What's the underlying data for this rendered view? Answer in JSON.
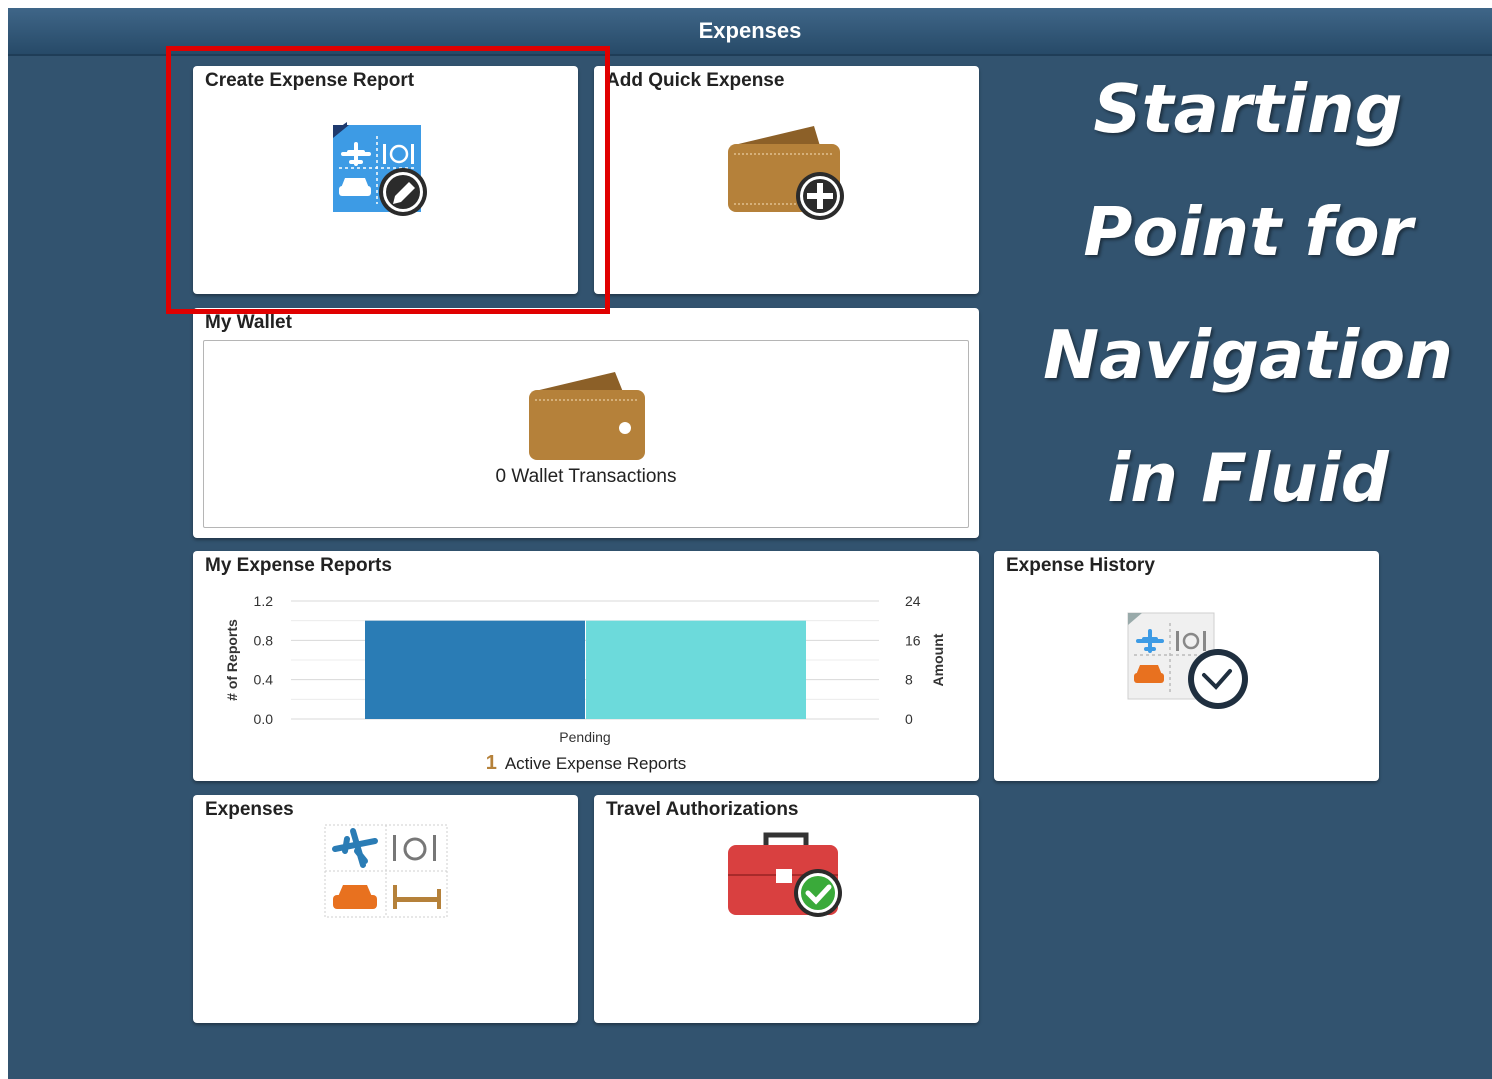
{
  "header": {
    "title": "Expenses"
  },
  "tiles": {
    "create_expense_report": {
      "title": "Create Expense Report"
    },
    "add_quick_expense": {
      "title": "Add Quick Expense"
    },
    "my_wallet": {
      "title": "My Wallet",
      "transactions": "0 Wallet Transactions"
    },
    "my_expense_reports": {
      "title": "My Expense Reports",
      "count": "1",
      "count_label": "Active Expense Reports"
    },
    "expense_history": {
      "title": "Expense History"
    },
    "expenses": {
      "title": "Expenses"
    },
    "travel_authorizations": {
      "title": "Travel Authorizations"
    }
  },
  "tagline": {
    "lines": [
      "Starting",
      "Point for",
      "Navigation",
      "in Fluid"
    ]
  },
  "chart_data": {
    "type": "bar",
    "categories": [
      "Pending"
    ],
    "series": [
      {
        "axis": "left",
        "values": [
          1
        ],
        "color": "#2a7cb5"
      },
      {
        "axis": "right",
        "values": [
          20
        ],
        "color": "#6cdadb"
      }
    ],
    "ylabel": "# of Reports",
    "ylabel_right": "Amount",
    "ylim": [
      0,
      1.2
    ],
    "yticks": [
      "0.0",
      "0.4",
      "0.8",
      "1.2"
    ],
    "ylim_right": [
      0,
      24
    ],
    "yticks_right": [
      "0",
      "8",
      "16",
      "24"
    ],
    "grid": true
  },
  "colors": {
    "background": "#32536f",
    "header": "#2d5273",
    "highlight": "#e00000",
    "wallet": "#b5813a",
    "report_blue": "#3d9be5",
    "suitcase_red": "#d94040",
    "check_green": "#3aaa3a",
    "taxi_orange": "#e8711f"
  }
}
